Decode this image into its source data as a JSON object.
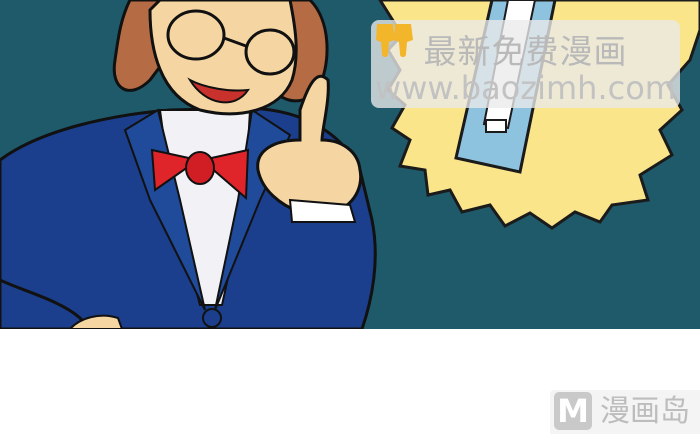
{
  "watermark": {
    "title": "最新免费漫画",
    "url": "www.baozimh.com"
  },
  "logo": {
    "letter": "M",
    "text": "漫画岛"
  }
}
